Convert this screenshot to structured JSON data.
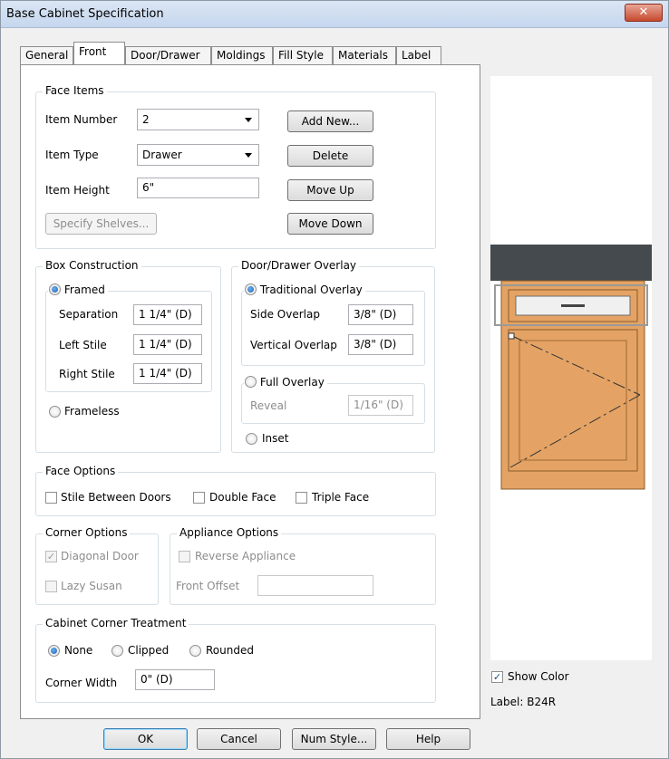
{
  "window": {
    "title": "Base Cabinet Specification",
    "close_glyph": "✕"
  },
  "tabs": [
    "General",
    "Front",
    "Door/Drawer",
    "Moldings",
    "Fill Style",
    "Materials",
    "Label"
  ],
  "face_items": {
    "group_label": "Face Items",
    "item_number_label": "Item Number",
    "item_number_value": "2",
    "item_type_label": "Item Type",
    "item_type_value": "Drawer",
    "item_height_label": "Item Height",
    "item_height_value": "6\"",
    "specify_shelves": "Specify Shelves...",
    "add_new": "Add New...",
    "delete": "Delete",
    "move_up": "Move Up",
    "move_down": "Move Down"
  },
  "box_construction": {
    "group_label": "Box Construction",
    "framed": "Framed",
    "separation_label": "Separation",
    "separation_value": "1 1/4\" (D)",
    "left_stile_label": "Left Stile",
    "left_stile_value": "1 1/4\" (D)",
    "right_stile_label": "Right Stile",
    "right_stile_value": "1 1/4\" (D)",
    "frameless": "Frameless"
  },
  "overlay": {
    "group_label": "Door/Drawer Overlay",
    "traditional": "Traditional Overlay",
    "side_overlap_label": "Side Overlap",
    "side_overlap_value": "3/8\" (D)",
    "vertical_overlap_label": "Vertical Overlap",
    "vertical_overlap_value": "3/8\" (D)",
    "full_overlay": "Full Overlay",
    "reveal_label": "Reveal",
    "reveal_value": "1/16\" (D)",
    "inset": "Inset"
  },
  "face_options": {
    "group_label": "Face Options",
    "stile_between_doors": "Stile Between Doors",
    "double_face": "Double Face",
    "triple_face": "Triple Face"
  },
  "corner_options": {
    "group_label": "Corner Options",
    "diagonal_door": "Diagonal Door",
    "lazy_susan": "Lazy Susan"
  },
  "appliance_options": {
    "group_label": "Appliance Options",
    "reverse_appliance": "Reverse Appliance",
    "front_offset_label": "Front Offset",
    "front_offset_value": ""
  },
  "corner_treatment": {
    "group_label": "Cabinet Corner Treatment",
    "none": "None",
    "clipped": "Clipped",
    "rounded": "Rounded",
    "corner_width_label": "Corner Width",
    "corner_width_value": "0\" (D)"
  },
  "preview": {
    "show_color": "Show Color",
    "label_text": "Label: B24R",
    "colors": {
      "countertop": "#454a4f",
      "wood": "#e4a364",
      "wood_dark": "#b9763c",
      "drawer_front": "#f0f0f0"
    }
  },
  "buttons": {
    "ok": "OK",
    "cancel": "Cancel",
    "num_style": "Num Style...",
    "help": "Help"
  },
  "check_glyph": "✓"
}
